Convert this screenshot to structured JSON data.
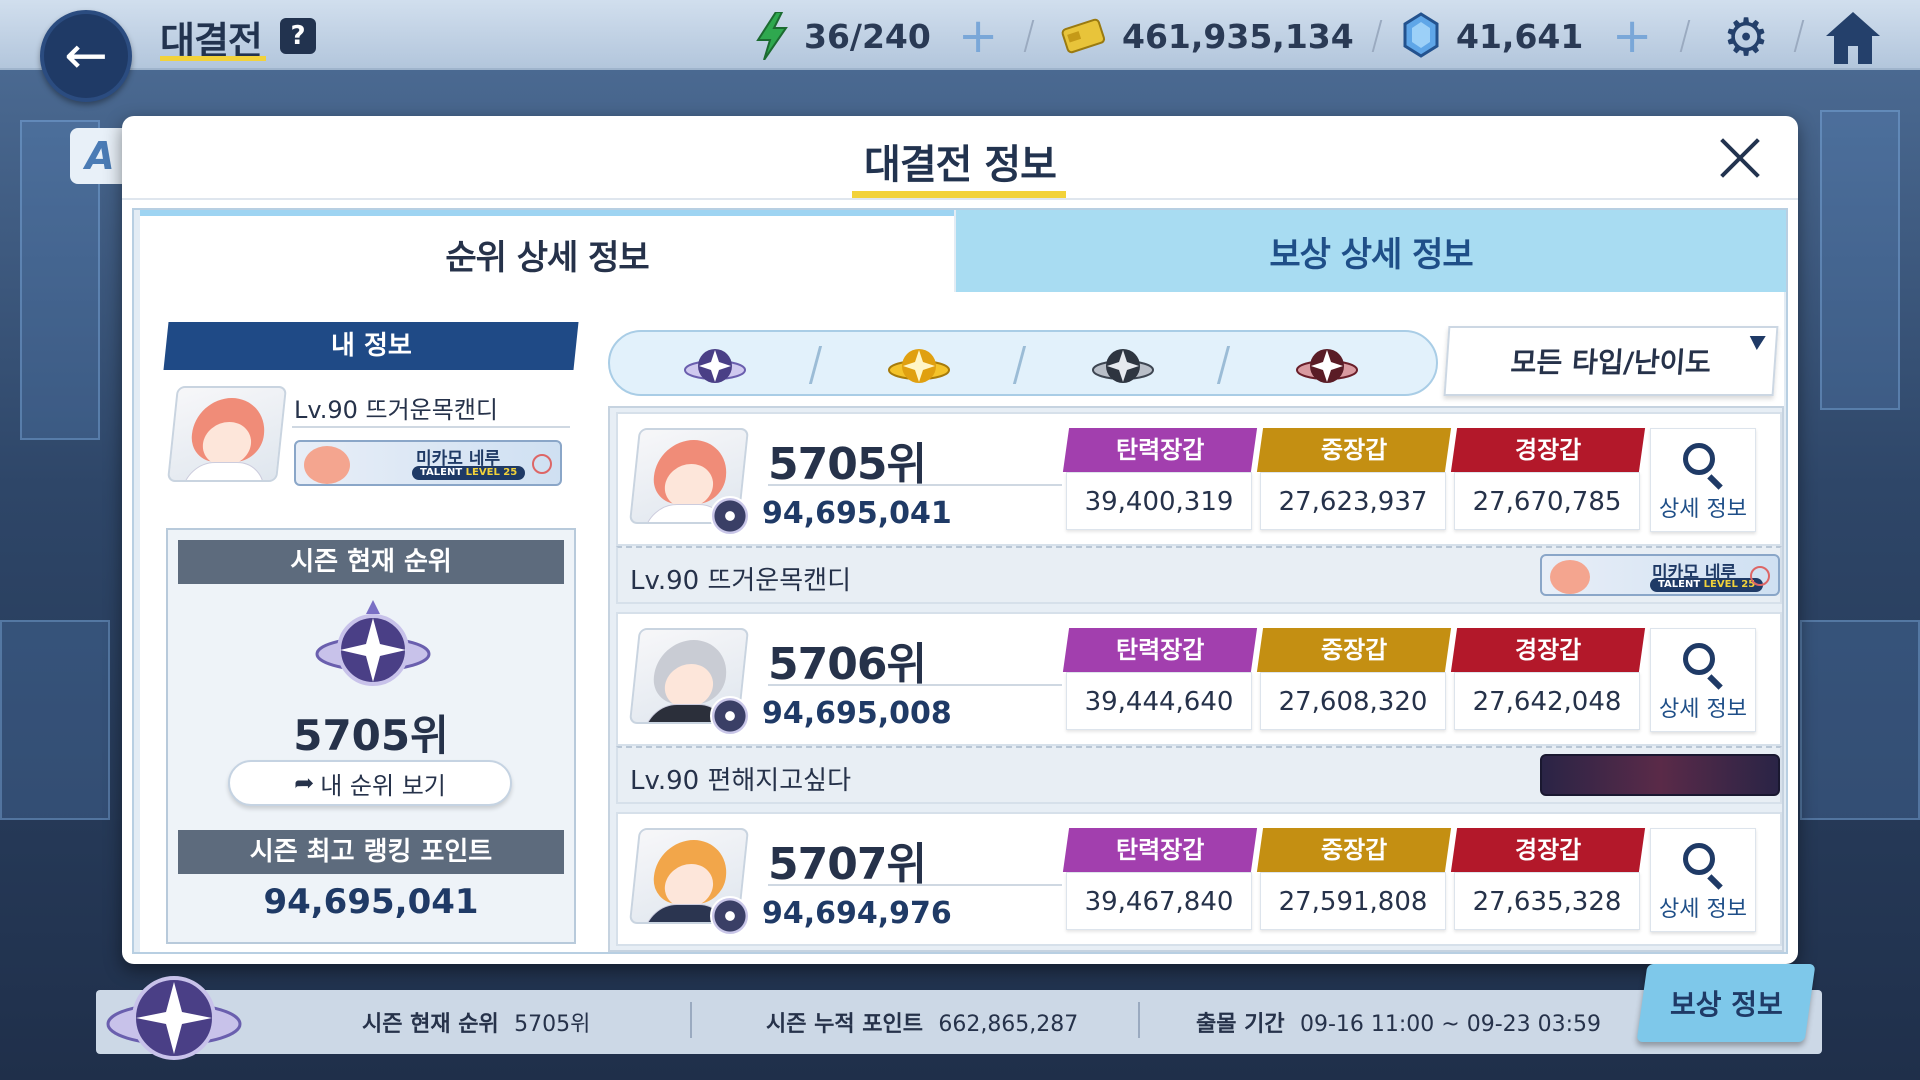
{
  "header": {
    "title": "대결전",
    "help": "?",
    "stamina": "36/240",
    "credits": "461,935,134",
    "gems": "41,641"
  },
  "side_tab": "A",
  "modal": {
    "title": "대결전 정보",
    "tabs": [
      {
        "label": "순위 상세 정보",
        "active": true
      },
      {
        "label": "보상 상세 정보",
        "active": false
      }
    ]
  },
  "my_info": {
    "banner": "내 정보",
    "level_name": "Lv.90 뜨거운목캔디",
    "badge": {
      "name": "미카모 네루",
      "talent": "TALENT",
      "level": "LEVEL 25"
    },
    "season_rank_label": "시즌 현재 순위",
    "season_rank": "5705위",
    "my_rank_button": "내 순위 보기",
    "best_points_label": "시즌 최고 랭킹 포인트",
    "best_points": "94,695,041"
  },
  "filter": {
    "selected": "모든 타입/난이도",
    "emblems": [
      "purple-emblem",
      "gold-emblem",
      "dark-emblem",
      "red-emblem"
    ]
  },
  "entries": [
    {
      "rank": "5705위",
      "points": "94,695,041",
      "stats": [
        {
          "label": "탄력장갑",
          "value": "39,400,319",
          "color": "#a23fae"
        },
        {
          "label": "중장갑",
          "value": "27,623,937",
          "color": "#c48f12"
        },
        {
          "label": "경장갑",
          "value": "27,670,785",
          "color": "#b3182a"
        }
      ],
      "detail": "상세 정보",
      "level_name": "Lv.90  뜨거운목캔디",
      "hair_color": "#f08c78",
      "badge": {
        "name": "미카모 네루",
        "talent": "TALENT",
        "level": "LEVEL 25",
        "type": "card"
      }
    },
    {
      "rank": "5706위",
      "points": "94,695,008",
      "stats": [
        {
          "label": "탄력장갑",
          "value": "39,444,640",
          "color": "#a23fae"
        },
        {
          "label": "중장갑",
          "value": "27,608,320",
          "color": "#c48f12"
        },
        {
          "label": "경장갑",
          "value": "27,642,048",
          "color": "#b3182a"
        }
      ],
      "detail": "상세 정보",
      "level_name": "Lv.90  편해지고싶다",
      "hair_color": "#c9ccd4",
      "badge": {
        "type": "dark"
      }
    },
    {
      "rank": "5707위",
      "points": "94,694,976",
      "stats": [
        {
          "label": "탄력장갑",
          "value": "39,467,840",
          "color": "#a23fae"
        },
        {
          "label": "중장갑",
          "value": "27,591,808",
          "color": "#c48f12"
        },
        {
          "label": "경장갑",
          "value": "27,635,328",
          "color": "#b3182a"
        }
      ],
      "detail": "상세 정보",
      "hair_color": "#f2a64a"
    }
  ],
  "bottom": {
    "season_rank_label": "시즌 현재 순위",
    "season_rank": "5705위",
    "season_points_label": "시즌 누적 포인트",
    "season_points": "662,865,287",
    "period_label": "출몰 기간",
    "period": "09-16 11:00 ~ 09-23 03:59",
    "reward_button": "보상 정보"
  }
}
